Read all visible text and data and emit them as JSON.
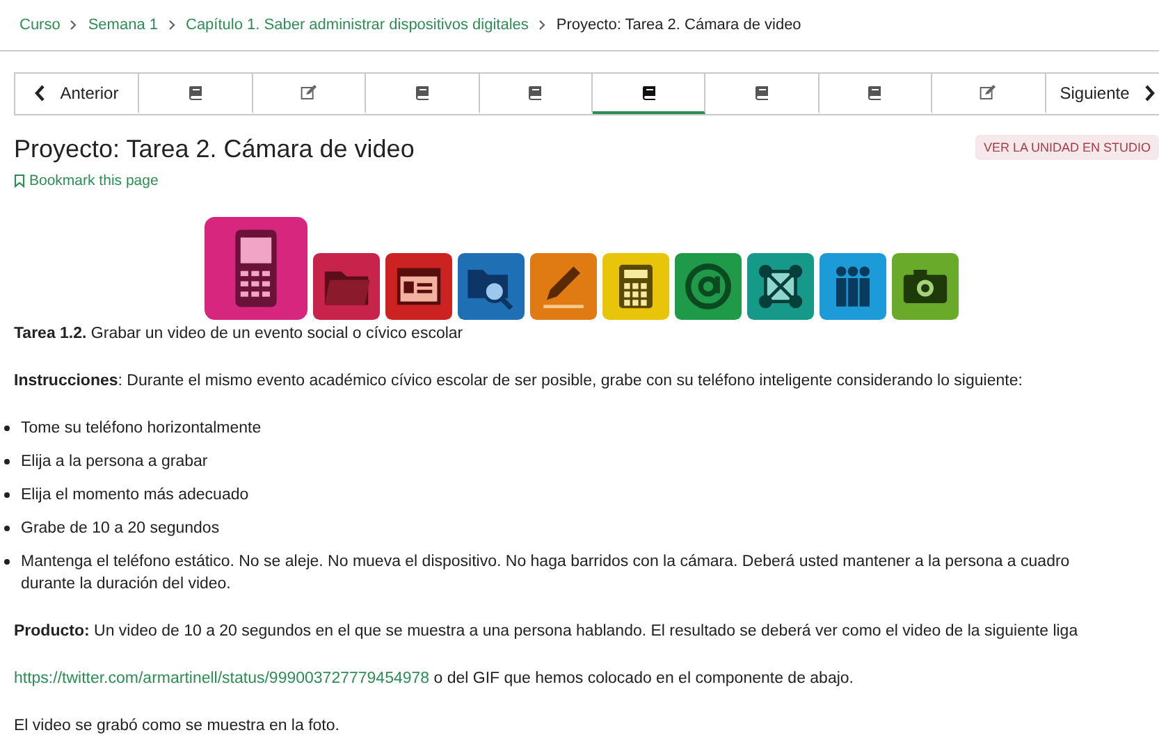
{
  "breadcrumbs": [
    {
      "label": "Curso",
      "link": true
    },
    {
      "label": "Semana 1",
      "link": true
    },
    {
      "label": "Capítulo 1. Saber administrar dispositivos digitales",
      "link": true
    },
    {
      "label": "Proyecto: Tarea 2. Cámara de video",
      "link": false
    }
  ],
  "sequence_nav": [
    {
      "kind": "prev",
      "label": "Anterior",
      "selected": false
    },
    {
      "kind": "reading",
      "selected": false
    },
    {
      "kind": "task",
      "selected": false
    },
    {
      "kind": "reading",
      "selected": false
    },
    {
      "kind": "reading",
      "selected": false
    },
    {
      "kind": "reading",
      "selected": true
    },
    {
      "kind": "reading",
      "selected": false
    },
    {
      "kind": "reading",
      "selected": false
    },
    {
      "kind": "task",
      "selected": false
    },
    {
      "kind": "next",
      "label": "Siguiente",
      "selected": false
    }
  ],
  "title": "Proyecto: Tarea 2. Cámara de video",
  "studio_button": "VER LA UNIDAD EN STUDIO",
  "bookmark": "Bookmark this page",
  "banner": {
    "kind": "icon-strip"
  },
  "task_line": "**Tarea 1.2.** Grabar un video de un evento social o cívico escolar",
  "instructions": "**Instrucciones**: Durante el mismo evento académico cívico escolar de ser posible, grabe con su teléfono inteligente considerando lo siguiente:",
  "bullets": [
    "Tome su teléfono horizontalmente",
    "Elija a la persona a grabar",
    "Elija el momento más adecuado",
    "Grabe de 10 a 20 segundos",
    "Mantenga el teléfono estático. No se aleje. No mueva el dispositivo. No haga barridos con la cámara. Deberá usted mantener a la persona a cuadro durante la duración del video."
  ],
  "product": "**Producto:** Un video de 10 a 20 segundos en el que se muestra a una persona hablando. El resultado se deberá ver como el video de la siguiente liga",
  "link": {
    "url": "https://twitter.com/armartinell/status/999003727779454978",
    "rest": " o del GIF que hemos colocado en el componente de abajo."
  },
  "closing": "El video se grabó como se muestra en la foto."
}
